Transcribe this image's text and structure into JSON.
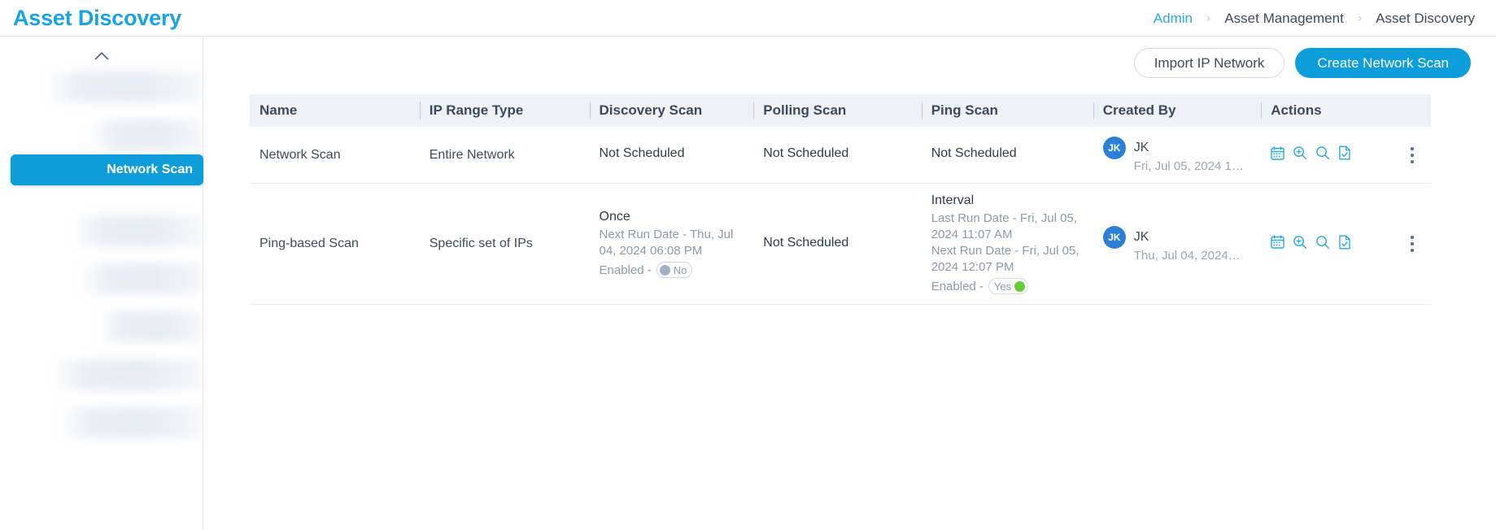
{
  "header": {
    "title": "Asset Discovery",
    "breadcrumb": [
      {
        "label": "Admin",
        "link": true
      },
      {
        "label": "Asset Management",
        "link": false
      },
      {
        "label": "Asset Discovery",
        "link": false
      }
    ],
    "separator": "›"
  },
  "sidebar": {
    "collapse_icon": "chevron-up-icon",
    "active_item": "Network Scan",
    "items": [
      {
        "label": "",
        "redacted": true
      },
      {
        "label": "",
        "redacted": true
      },
      {
        "label": "Network Scan",
        "redacted": false
      },
      {
        "label": "",
        "redacted": true
      },
      {
        "label": "",
        "redacted": true
      },
      {
        "label": "",
        "redacted": true
      },
      {
        "label": "",
        "redacted": true
      },
      {
        "label": "",
        "redacted": true
      }
    ]
  },
  "toolbar": {
    "import_label": "Import IP Network",
    "create_label": "Create Network Scan"
  },
  "table": {
    "columns": [
      "Name",
      "IP Range Type",
      "Discovery Scan",
      "Polling Scan",
      "Ping Scan",
      "Created By",
      "Actions"
    ],
    "rows": [
      {
        "name": "Network Scan",
        "ip_range_type": "Entire Network",
        "discovery_scan": {
          "mode": "Not Scheduled",
          "lines": [],
          "enabled_label": null,
          "enabled": null
        },
        "polling_scan": {
          "mode": "Not Scheduled",
          "lines": [],
          "enabled_label": null,
          "enabled": null
        },
        "ping_scan": {
          "mode": "Not Scheduled",
          "lines": [],
          "enabled_label": null,
          "enabled": null
        },
        "created_by": {
          "initials": "JK",
          "name": "JK",
          "date": "Fri, Jul 05, 2024 1…"
        }
      },
      {
        "name": "Ping-based Scan",
        "ip_range_type": "Specific set of IPs",
        "discovery_scan": {
          "mode": "Once",
          "lines": [
            "Next Run Date - Thu, Jul 04, 2024 06:08 PM"
          ],
          "enabled_label": "Enabled -",
          "enabled": "No"
        },
        "polling_scan": {
          "mode": "Not Scheduled",
          "lines": [],
          "enabled_label": null,
          "enabled": null
        },
        "ping_scan": {
          "mode": "Interval",
          "lines": [
            "Last Run Date - Fri, Jul 05, 2024 11:07 AM",
            "Next Run Date - Fri, Jul 05, 2024 12:07 PM"
          ],
          "enabled_label": "Enabled -",
          "enabled": "Yes"
        },
        "created_by": {
          "initials": "JK",
          "name": "JK",
          "date": "Thu, Jul 04, 2024…"
        }
      }
    ],
    "action_icons": [
      "calendar-icon",
      "zoom-in-icon",
      "search-icon",
      "document-check-icon"
    ],
    "kebab_icon": "more-vertical-icon"
  },
  "colors": {
    "accent": "#0d9ddb",
    "title": "#1aa3e0",
    "header_bg": "#eef1f6",
    "text": "#3e4a5c",
    "muted": "#8e99a8",
    "avatar": "#2b7fd4",
    "toggle_on": "#66cc33",
    "toggle_off": "#9fb2c8"
  }
}
